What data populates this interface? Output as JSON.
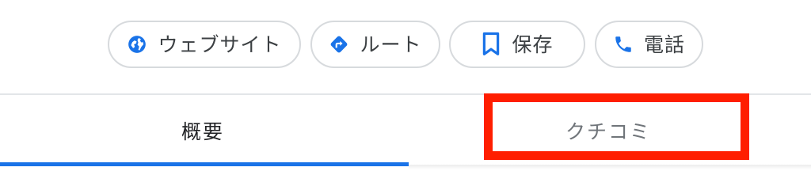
{
  "actions": {
    "website": {
      "label": "ウェブサイト",
      "icon": "globe-icon"
    },
    "route": {
      "label": "ルート",
      "icon": "directions-icon"
    },
    "save": {
      "label": "保存",
      "icon": "bookmark-icon"
    },
    "call": {
      "label": "電話",
      "icon": "phone-icon"
    }
  },
  "tabs": [
    {
      "label": "概要",
      "active": true
    },
    {
      "label": "クチコミ",
      "active": false
    }
  ],
  "colors": {
    "accent": "#1a73e8",
    "chip_border": "#d7dadd",
    "text": "#3c4043",
    "inactive_tab": "#70757a",
    "highlight": "#ff1e00"
  }
}
